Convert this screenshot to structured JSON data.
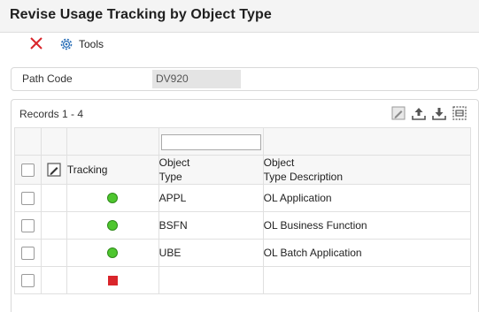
{
  "window": {
    "title": "Revise Usage Tracking by Object Type"
  },
  "toolbar": {
    "tools_label": "Tools"
  },
  "path_code": {
    "label": "Path Code",
    "value": "DV920"
  },
  "grid": {
    "records_label": "Records 1 - 4",
    "columns": {
      "tracking": "Tracking",
      "object_type": [
        "Object",
        "Type"
      ],
      "object_type_description": [
        "Object",
        "Type Description"
      ]
    },
    "rows": [
      {
        "tracking_status": "active",
        "object_type": "APPL",
        "description": "OL Application"
      },
      {
        "tracking_status": "active",
        "object_type": "BSFN",
        "description": "OL Business Function"
      },
      {
        "tracking_status": "active",
        "object_type": "UBE",
        "description": "OL Batch Application"
      },
      {
        "tracking_status": "inactive",
        "object_type": "",
        "description": ""
      }
    ]
  },
  "colors": {
    "active_green": "#4ec62e",
    "inactive_red": "#d9252b",
    "close_red": "#d9252b",
    "tools_blue": "#2a6fb8"
  },
  "icons": [
    "close-icon",
    "gear-icon",
    "edit-icon",
    "export-icon",
    "download-icon",
    "grid-settings-icon"
  ]
}
